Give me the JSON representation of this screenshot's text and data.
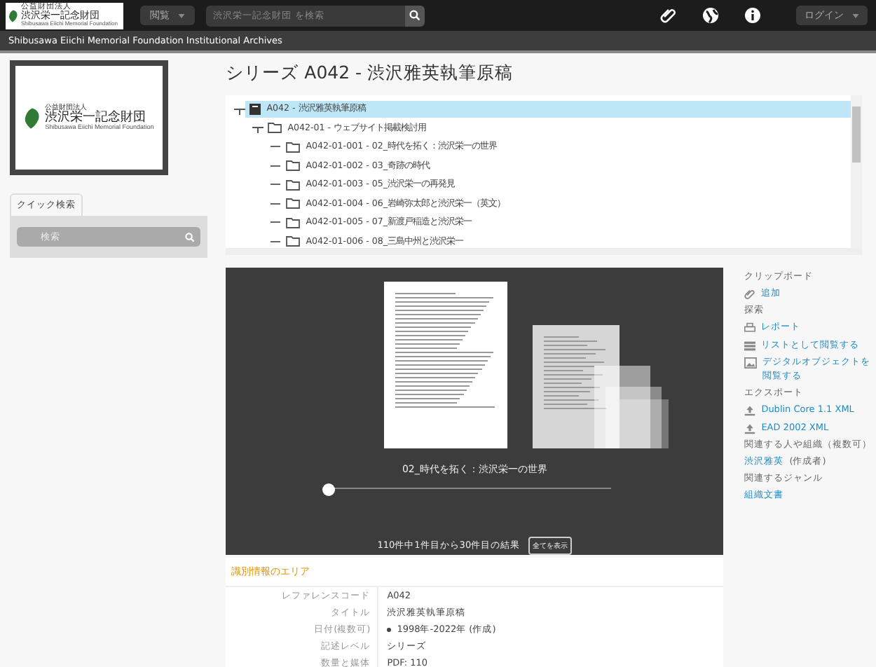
{
  "header": {
    "logo": {
      "line1": "公益財団法人",
      "line2": "渋沢栄一記念財団",
      "line3": "Shibusawa Eiichi Memorial Foundation"
    },
    "browse": "閲覧",
    "search": {
      "placeholder": "渋沢栄一記念財団 を検索"
    },
    "login": "ログイン"
  },
  "site_title": "Shibusawa Eiichi Memorial Foundation Institutional Archives",
  "sidebar": {
    "logo": {
      "line1": "公益財団法人",
      "line2": "渋沢栄一記念財団",
      "line3": "Shibusawa Eiichi Memorial Foundation"
    },
    "quick_search_tab": "クイック検索",
    "search": {
      "placeholder": "検索"
    }
  },
  "page_title": "シリーズ A042 - 渋沢雅英執筆原稿",
  "tree": [
    {
      "label": "A042 - 渋沢雅英執筆原稿",
      "kind": "series",
      "selected": true,
      "expanded": true,
      "children": [
        {
          "label": "A042-01 - ウェブサイト掲載検討用",
          "kind": "folder",
          "selected": false,
          "expanded": true,
          "children": [
            {
              "label": "A042-01-001 - 02_時代を拓く：渋沢栄一の世界",
              "kind": "folder",
              "selected": false
            },
            {
              "label": "A042-01-002 - 03_奇跡の時代",
              "kind": "folder",
              "selected": false
            },
            {
              "label": "A042-01-003 - 05_渋沢栄一の再発見",
              "kind": "folder",
              "selected": false
            },
            {
              "label": "A042-01-004 - 06_岩崎弥太郎と渋沢栄一（英文）",
              "kind": "folder",
              "selected": false
            },
            {
              "label": "A042-01-005 - 07_新渡戸稲造と渋沢栄一",
              "kind": "folder",
              "selected": false
            },
            {
              "label": "A042-01-006 - 08_三島中州と渋沢栄一",
              "kind": "folder",
              "selected": false
            }
          ]
        }
      ]
    }
  ],
  "carousel": {
    "caption": "02_時代を拓く：渋沢栄一の世界",
    "slider": {
      "level": 0
    },
    "results": "110件中1件目から30件目の結果",
    "show_all": "全てを表示"
  },
  "identity": {
    "heading": "識別情報のエリア",
    "fields": [
      {
        "label": "レファレンスコード",
        "value": "A042",
        "kind": "text"
      },
      {
        "label": "タイトル",
        "value": "渋沢雅英執筆原稿",
        "kind": "text"
      },
      {
        "label": "日付(複数可)",
        "value": "1998年-2022年 (作成)",
        "kind": "list"
      },
      {
        "label": "記述レベル",
        "value": "シリーズ",
        "kind": "text"
      },
      {
        "label": "数量と媒体",
        "value": "PDF: 110",
        "kind": "text"
      }
    ]
  },
  "right": [
    {
      "heading": "クリップボード",
      "links": [
        {
          "label": "追加",
          "kind": "clip"
        }
      ]
    },
    {
      "heading": "探索",
      "links": [
        {
          "label": "レポート",
          "kind": "report"
        },
        {
          "label": "リストとして閲覧する",
          "kind": "listview"
        },
        {
          "label": "デジタルオブジェクトを閲覧する",
          "kind": "media"
        }
      ]
    },
    {
      "heading": "エクスポート",
      "links": [
        {
          "label": "Dublin Core 1.1 XML",
          "kind": "export"
        },
        {
          "label": "EAD 2002 XML",
          "kind": "export"
        }
      ]
    },
    {
      "heading": "関連する人や組織（複数可）",
      "links": [
        {
          "label": "渋沢雅英",
          "suffix": " (作成者)",
          "kind": "plain"
        }
      ]
    },
    {
      "heading": "関連するジャンル",
      "links": [
        {
          "label": "組織文書",
          "kind": "plain"
        }
      ]
    }
  ]
}
